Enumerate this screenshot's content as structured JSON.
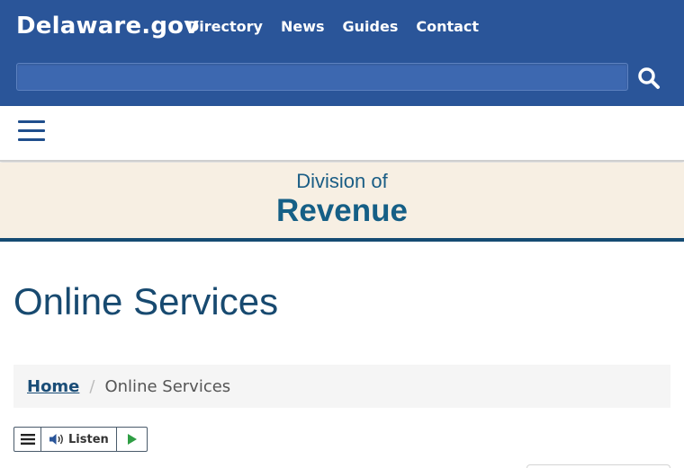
{
  "header": {
    "brand": "Delaware.gov",
    "nav": [
      "Directory",
      "News",
      "Guides",
      "Contact"
    ],
    "search": {
      "value": "",
      "placeholder": ""
    },
    "colors": {
      "bar": "#2a5599",
      "text": "#ffffff"
    }
  },
  "menu": {
    "icon": "hamburger-menu-icon"
  },
  "banner": {
    "line1": "Division of",
    "line2": "Revenue",
    "colors": {
      "background": "#f7efe3",
      "text": "#155f86",
      "border": "#154b72"
    }
  },
  "page": {
    "title": "Online Services"
  },
  "breadcrumb": {
    "home": "Home",
    "separator": "/",
    "current": "Online Services"
  },
  "readspeaker": {
    "listen_label": "Listen",
    "icons": [
      "menu-lines-icon",
      "speaker-icon",
      "play-icon"
    ]
  }
}
